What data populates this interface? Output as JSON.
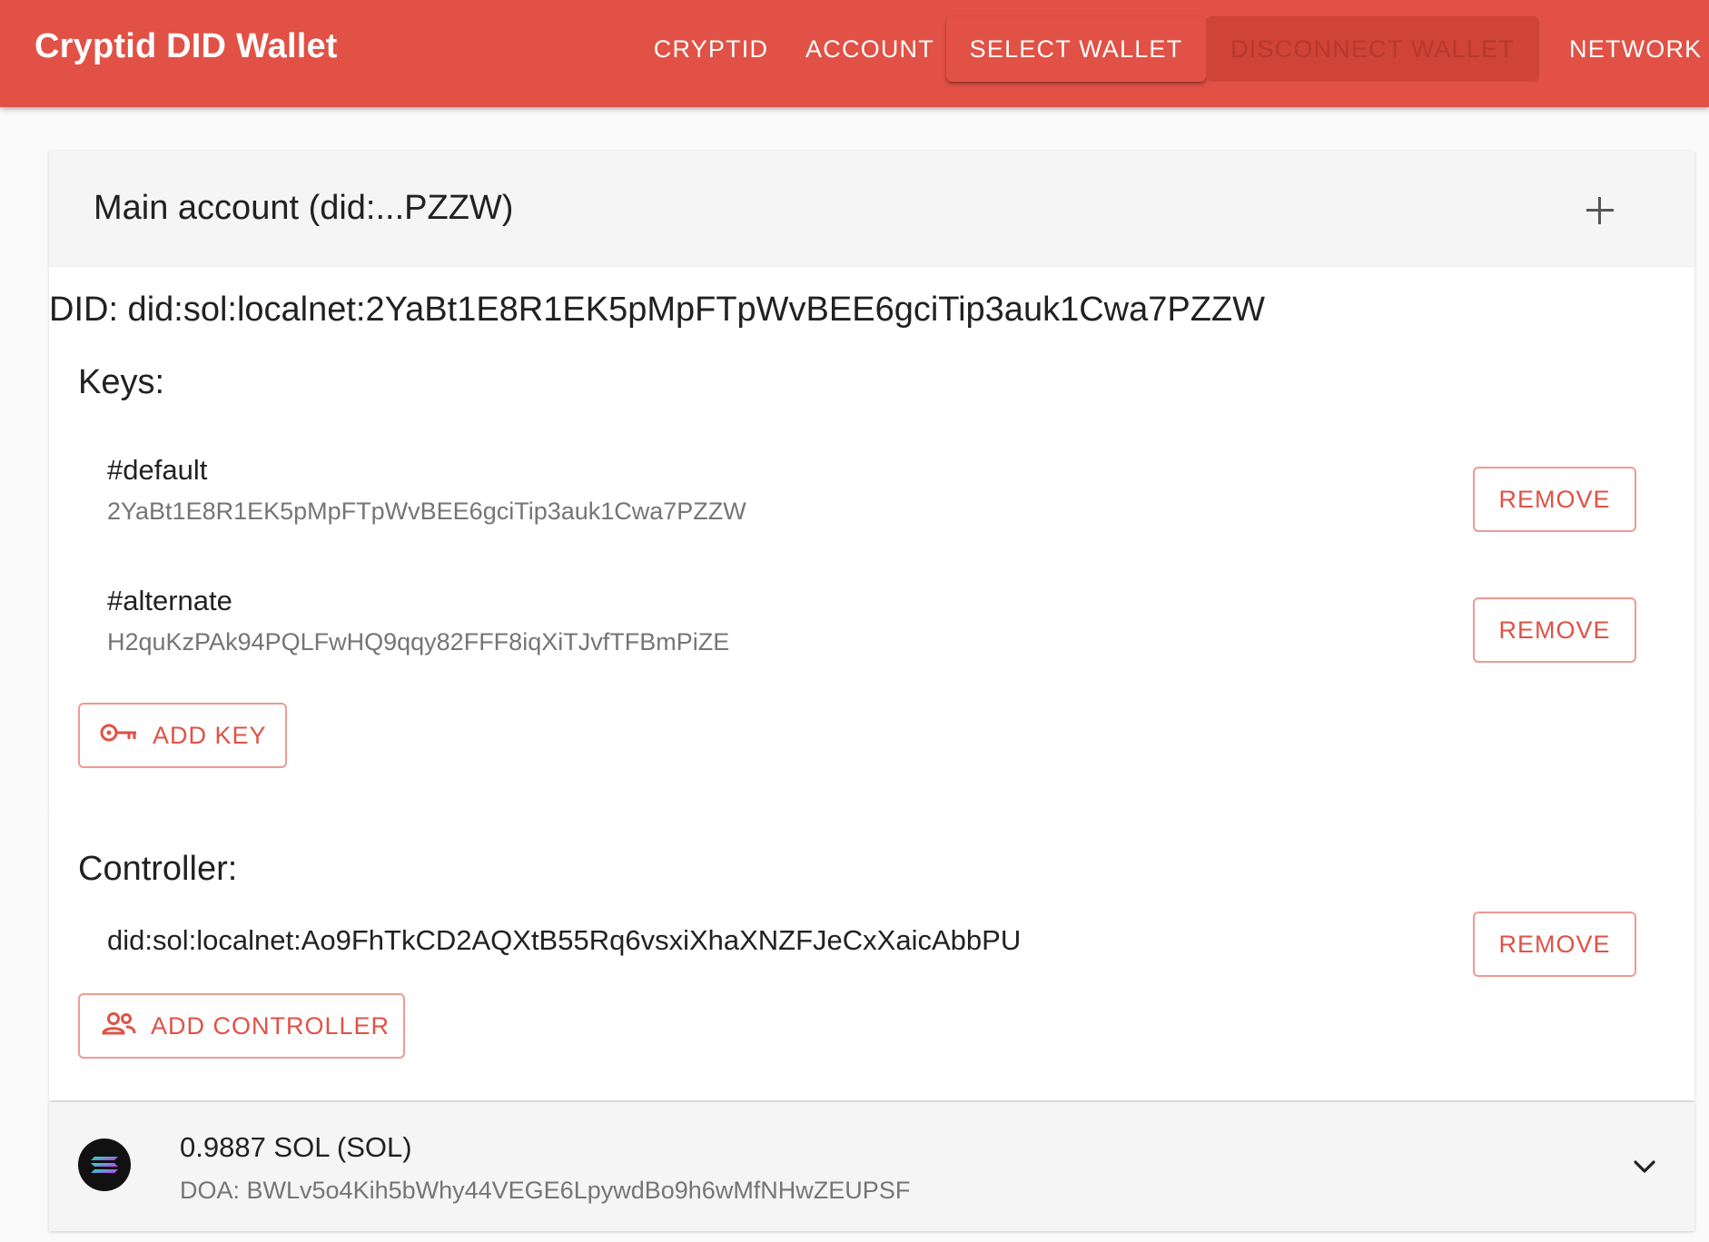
{
  "app": {
    "title": "Cryptid DID Wallet"
  },
  "nav": {
    "cryptid": "CRYPTID",
    "account": "ACCOUNT",
    "select_wallet": "SELECT WALLET",
    "disconnect_wallet": "DISCONNECT WALLET",
    "network": "NETWORK"
  },
  "account": {
    "title": "Main account (did:...PZZW)",
    "did_line": "DID: did:sol:localnet:2YaBt1E8R1EK5pMpFTpWvBEE6gciTip3auk1Cwa7PZZW",
    "keys_heading": "Keys:",
    "keys": [
      {
        "name": "#default",
        "value": "2YaBt1E8R1EK5pMpFTpWvBEE6gciTip3auk1Cwa7PZZW",
        "remove_label": "REMOVE"
      },
      {
        "name": "#alternate",
        "value": "H2quKzPAk94PQLFwHQ9qqy82FFF8iqXiTJvfTFBmPiZE",
        "remove_label": "REMOVE"
      }
    ],
    "add_key_label": "ADD KEY",
    "controller_heading": "Controller:",
    "controllers": [
      {
        "value": "did:sol:localnet:Ao9FhTkCD2AQXtB55Rq6vsxiXhaXNZFJeCxXaicAbbPU",
        "remove_label": "REMOVE"
      }
    ],
    "add_controller_label": "ADD CONTROLLER"
  },
  "token": {
    "amount": "0.9887 SOL (SOL)",
    "doa": "DOA: BWLv5o4Kih5bWhy44VEGE6LpywdBo9h6wMfNHwZEUPSF",
    "icon": "solana-logo-icon"
  },
  "colors": {
    "primary": "#e15145",
    "disconnect_bg": "#cf4338",
    "outline_border": "#ef9a93"
  }
}
